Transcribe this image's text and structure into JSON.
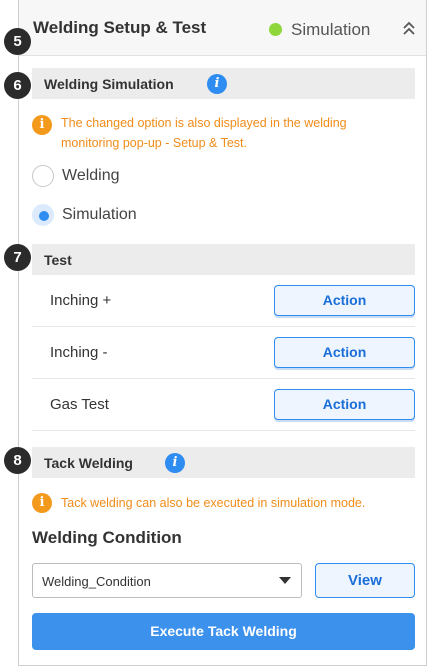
{
  "header": {
    "title": "Welding Setup & Test",
    "status_text": "Simulation",
    "status_color": "#8ed63a",
    "collapse_icon": "double-chevron-up-icon"
  },
  "badges": [
    "5",
    "6",
    "7",
    "8"
  ],
  "simulation_section": {
    "title": "Welding Simulation",
    "info_icon": "info-icon",
    "notice": "The changed option is also displayed in the welding monitoring pop-up - Setup & Test.",
    "options": [
      {
        "label": "Welding",
        "selected": false
      },
      {
        "label": "Simulation",
        "selected": true
      }
    ]
  },
  "test_section": {
    "title": "Test",
    "rows": [
      {
        "label": "Inching +",
        "button": "Action"
      },
      {
        "label": "Inching -",
        "button": "Action"
      },
      {
        "label": "Gas Test",
        "button": "Action"
      }
    ]
  },
  "tack_section": {
    "title": "Tack Welding",
    "info_icon": "info-icon",
    "notice": "Tack welding can also be executed in simulation mode.",
    "condition_title": "Welding Condition",
    "condition_value": "Welding_Condition",
    "view_button": "View",
    "execute_button": "Execute Tack Welding"
  },
  "colors": {
    "accent": "#2f8cf0",
    "notice": "#f08c1a",
    "primary_button": "#3b91ec"
  }
}
